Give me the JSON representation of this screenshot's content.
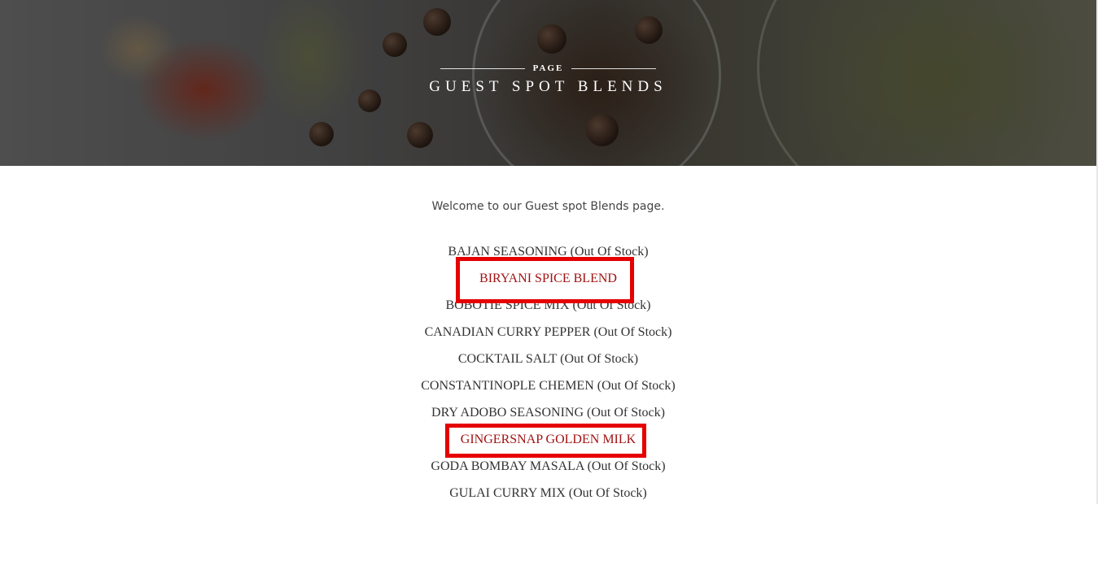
{
  "hero": {
    "eyebrow": "PAGE",
    "title": "GUEST SPOT BLENDS"
  },
  "welcome_text": "Welcome to our Guest spot Blends page.",
  "blends": [
    {
      "name": "BAJAN SEASONING",
      "stock": "(Out Of Stock)"
    },
    {
      "name": "BIRYANI SPICE BLEND",
      "stock": ""
    },
    {
      "name": "BOBOTIE SPICE MIX",
      "stock": "(Out Of Stock)"
    },
    {
      "name": "CANADIAN CURRY PEPPER",
      "stock": "(Out Of Stock)"
    },
    {
      "name": "COCKTAIL SALT",
      "stock": "(Out Of Stock)"
    },
    {
      "name": "CONSTANTINOPLE CHEMEN",
      "stock": "(Out Of Stock)"
    },
    {
      "name": "DRY ADOBO SEASONING",
      "stock": "(Out Of Stock)"
    },
    {
      "name": "GINGERSNAP GOLDEN MILK",
      "stock": ""
    },
    {
      "name": "GODA BOMBAY MASALA",
      "stock": "(Out Of Stock)"
    },
    {
      "name": "GULAI CURRY MIX",
      "stock": "(Out Of Stock)"
    }
  ],
  "colors": {
    "available_link": "#a11212",
    "highlight_box": "#e60000",
    "text": "#333333"
  }
}
